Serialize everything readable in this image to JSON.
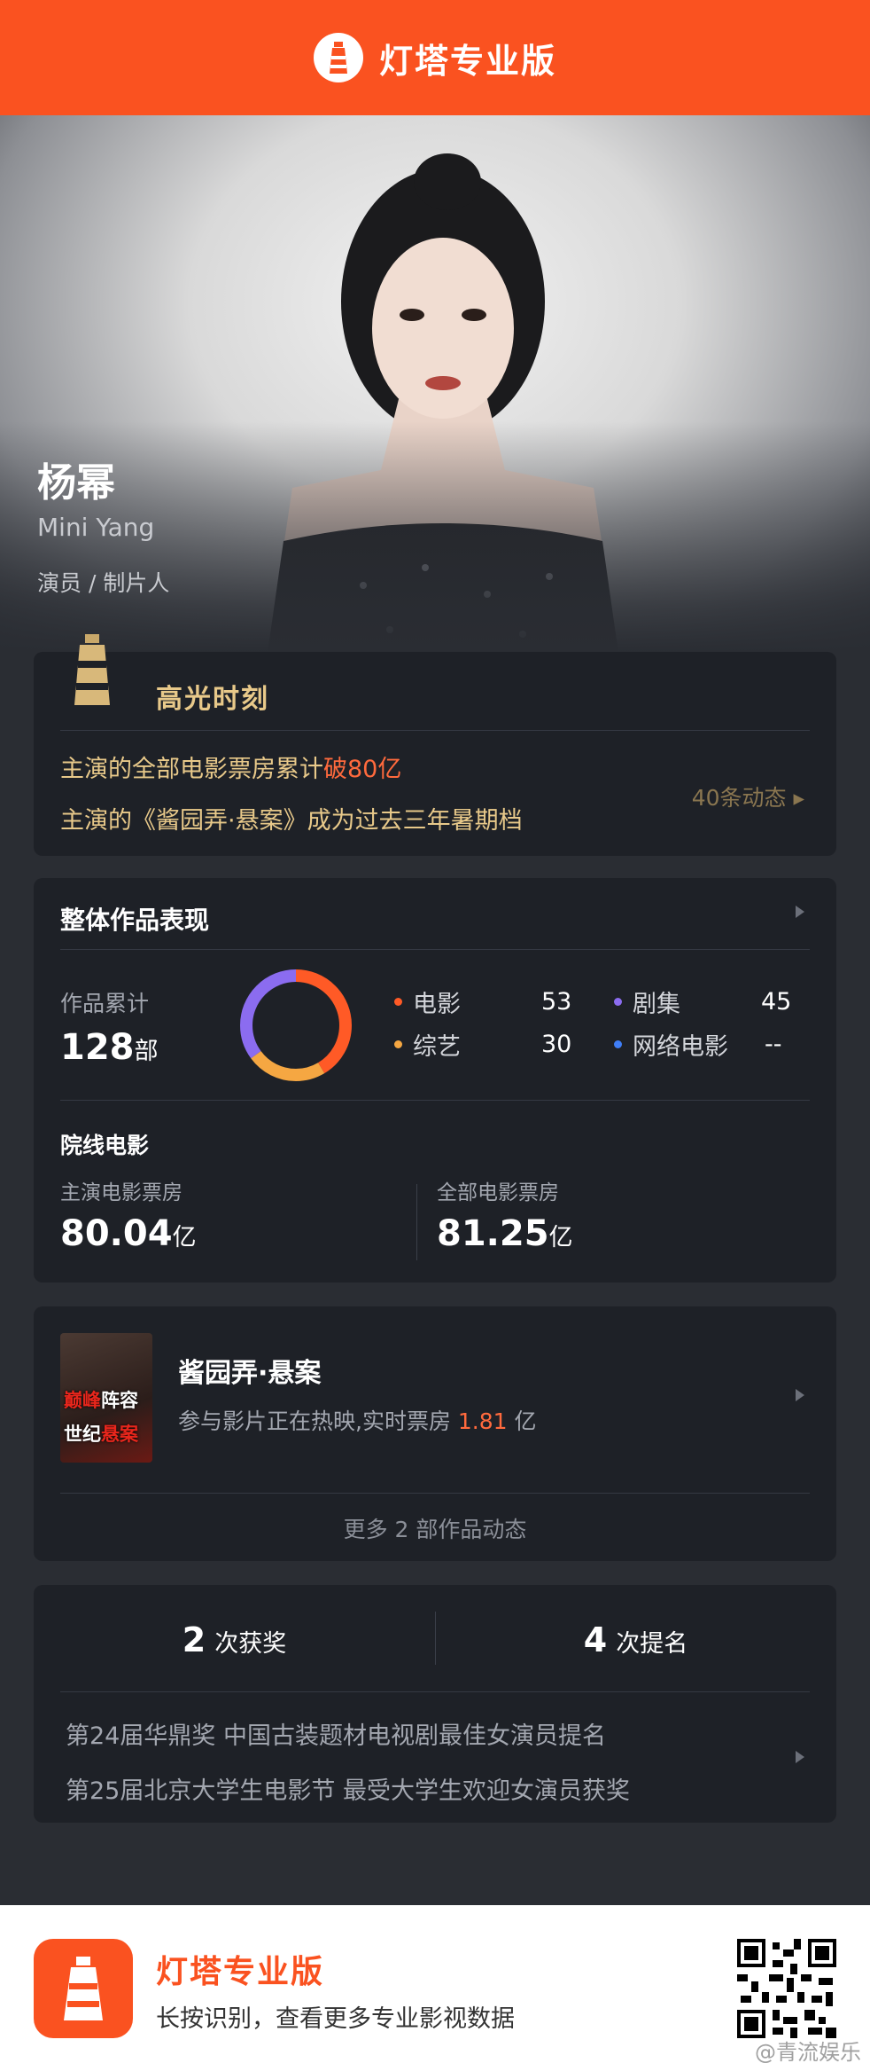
{
  "header": {
    "title": "灯塔专业版"
  },
  "profile": {
    "name": "杨幂",
    "english_name": "Mini Yang",
    "roles": "演员 / 制片人"
  },
  "highlight": {
    "title": "高光时刻",
    "line1_prefix": "主演的全部电影票房累计",
    "line1_highlight": "破80亿",
    "line2": "主演的《酱园弄·悬案》成为过去三年暑期档",
    "more": "40条动态 ▸"
  },
  "overview": {
    "title": "整体作品表现",
    "cumulative_label": "作品累计",
    "cumulative_value": "128",
    "cumulative_unit": "部",
    "legend": [
      {
        "label": "电影",
        "value": "53",
        "color": "#ff5a26"
      },
      {
        "label": "剧集",
        "value": "45",
        "color": "#8b6cf0"
      },
      {
        "label": "综艺",
        "value": "30",
        "color": "#f5a742"
      },
      {
        "label": "网络电影",
        "value": "--",
        "color": "#3f7ef7"
      }
    ],
    "cinema_title": "院线电影",
    "lead_box_office_label": "主演电影票房",
    "lead_box_office_value": "80.04",
    "total_box_office_label": "全部电影票房",
    "total_box_office_value": "81.25",
    "unit_yi": "亿"
  },
  "movie": {
    "poster_text_1a": "巅峰",
    "poster_text_1b": "阵容",
    "poster_text_2a": "世纪",
    "poster_text_2b": "悬案",
    "title": "酱园弄·悬案",
    "desc_prefix": "参与影片正在热映,实时票房 ",
    "desc_value": "1.81",
    "desc_unit": " 亿",
    "more": "更多 2 部作品动态"
  },
  "awards": {
    "wins_count": "2",
    "wins_label": "次获奖",
    "noms_count": "4",
    "noms_label": "次提名",
    "rows": [
      "第24届华鼎奖  中国古装题材电视剧最佳女演员提名",
      "第25届北京大学生电影节  最受大学生欢迎女演员获奖"
    ]
  },
  "footer": {
    "title": "灯塔专业版",
    "desc": "长按识别，查看更多专业影视数据",
    "watermark": "@青流娱乐"
  }
}
